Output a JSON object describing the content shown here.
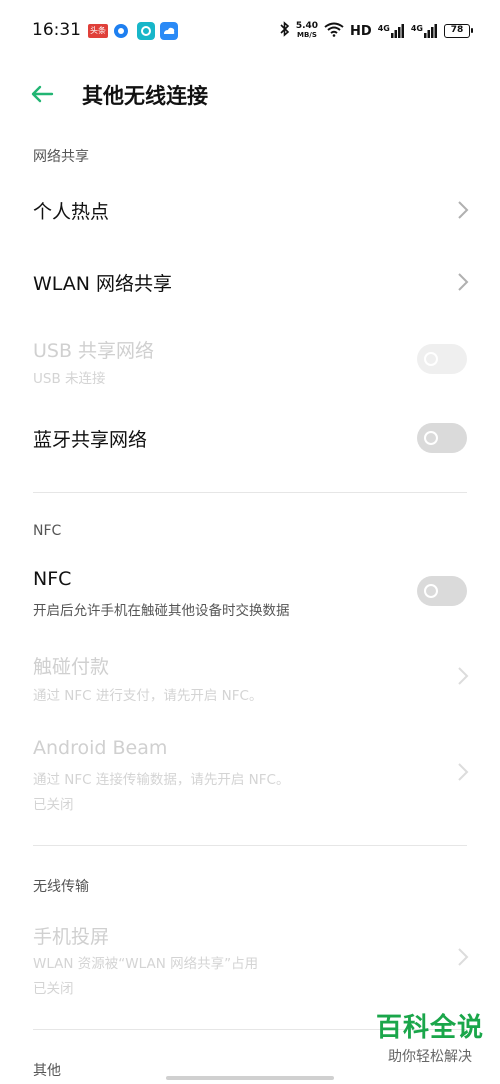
{
  "status_bar": {
    "time": "16:31",
    "app_badge": "头条",
    "speed_value": "5.40",
    "speed_unit": "MB/S",
    "hd_label": "HD",
    "net1": "4G",
    "net2": "4G",
    "battery": "78"
  },
  "header": {
    "title": "其他无线连接",
    "accent_color": "#22b573"
  },
  "sections": {
    "tethering": {
      "label": "网络共享",
      "hotspot": "个人热点",
      "wlan_share": "WLAN 网络共享",
      "usb_title": "USB 共享网络",
      "usb_sub": "USB 未连接",
      "bt_title": "蓝牙共享网络"
    },
    "nfc": {
      "label": "NFC",
      "nfc_title": "NFC",
      "nfc_sub": "开启后允许手机在触碰其他设备时交换数据",
      "pay_title": "触碰付款",
      "pay_sub": "通过 NFC 进行支付，请先开启 NFC。",
      "beam_title": "Android Beam",
      "beam_sub": "通过 NFC 连接传输数据，请先开启 NFC。",
      "beam_state": "已关闭"
    },
    "wireless": {
      "label": "无线传输",
      "cast_title": "手机投屏",
      "cast_sub": "WLAN 资源被“WLAN 网络共享”占用",
      "cast_state": "已关闭"
    },
    "other": {
      "label": "其他"
    }
  },
  "toggles": {
    "usb": false,
    "bluetooth": false,
    "nfc": false
  },
  "watermark": {
    "main": "百科全说",
    "sub": "助你轻松解决"
  }
}
